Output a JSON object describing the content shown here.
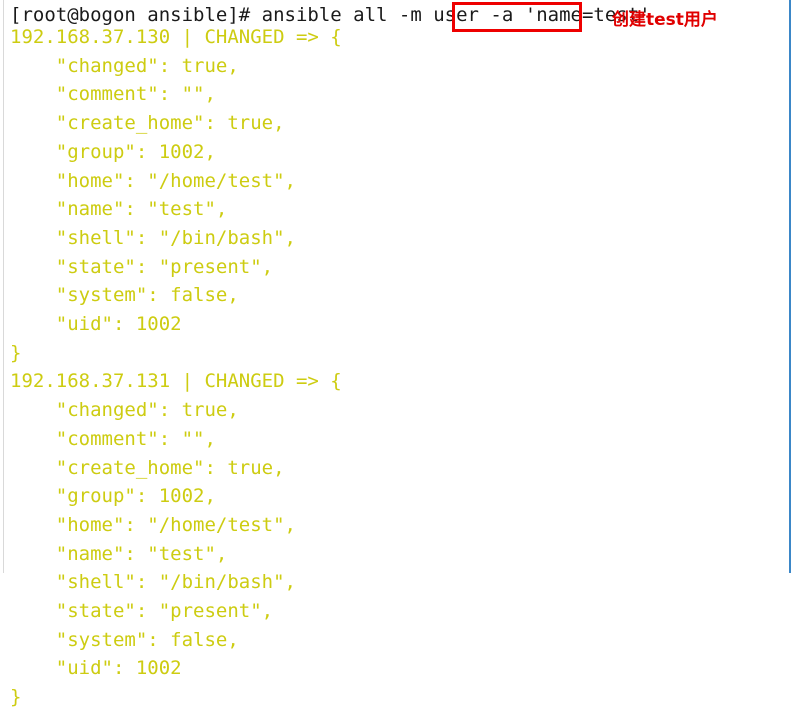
{
  "terminal": {
    "prompt_line": {
      "text": "[root@bogon ansible]# ansible all -m user -a 'name=test'",
      "color": "#1a1a1a"
    },
    "output_color": "#cdcc11",
    "lines": [
      {
        "text": "192.168.37.130 | CHANGED => {",
        "kind": "host-header"
      },
      {
        "text": "    \"changed\": true,",
        "kind": "json"
      },
      {
        "text": "    \"comment\": \"\",",
        "kind": "json"
      },
      {
        "text": "    \"create_home\": true,",
        "kind": "json"
      },
      {
        "text": "    \"group\": 1002,",
        "kind": "json"
      },
      {
        "text": "    \"home\": \"/home/test\",",
        "kind": "json"
      },
      {
        "text": "    \"name\": \"test\",",
        "kind": "json"
      },
      {
        "text": "    \"shell\": \"/bin/bash\",",
        "kind": "json"
      },
      {
        "text": "    \"state\": \"present\",",
        "kind": "json"
      },
      {
        "text": "    \"system\": false,",
        "kind": "json"
      },
      {
        "text": "    \"uid\": 1002",
        "kind": "json"
      },
      {
        "text": "}",
        "kind": "json"
      },
      {
        "text": "192.168.37.131 | CHANGED => {",
        "kind": "host-header"
      },
      {
        "text": "    \"changed\": true,",
        "kind": "json"
      },
      {
        "text": "    \"comment\": \"\",",
        "kind": "json"
      },
      {
        "text": "    \"create_home\": true,",
        "kind": "json"
      },
      {
        "text": "    \"group\": 1002,",
        "kind": "json"
      },
      {
        "text": "    \"home\": \"/home/test\",",
        "kind": "json"
      },
      {
        "text": "    \"name\": \"test\",",
        "kind": "json"
      },
      {
        "text": "    \"shell\": \"/bin/bash\",",
        "kind": "json"
      },
      {
        "text": "    \"state\": \"present\",",
        "kind": "json"
      },
      {
        "text": "    \"system\": false,",
        "kind": "json"
      },
      {
        "text": "    \"uid\": 1002",
        "kind": "json"
      },
      {
        "text": "}",
        "kind": "json"
      }
    ]
  },
  "annotation": {
    "text": "创建test用户",
    "color": "#e00000"
  },
  "highlight": {
    "target_text": "'name=test'",
    "color": "#ee0000"
  },
  "rules": {
    "left_color": "#d9d9d9",
    "right_color": "#3b87c8"
  }
}
